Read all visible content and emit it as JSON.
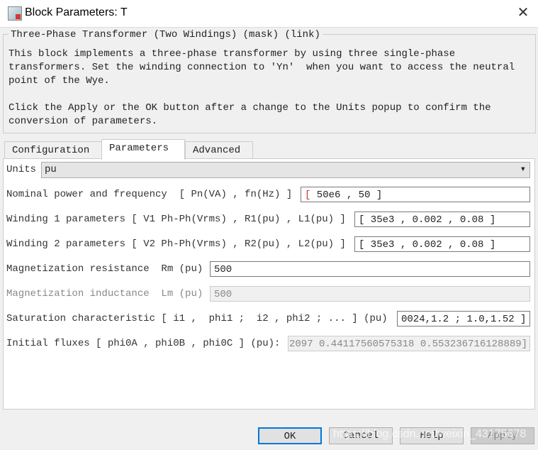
{
  "window": {
    "title": "Block Parameters: T",
    "close_icon": "close-icon"
  },
  "description": {
    "group_title": "Three-Phase Transformer (Two Windings) (mask) (link)",
    "lines": [
      "This block implements a three-phase transformer by using three single-phase",
      "transformers. Set the winding connection to 'Yn'  when you want to access the neutral",
      "point of the Wye.",
      "",
      "Click the Apply or the OK button after a change to the Units popup to confirm the",
      "conversion of parameters."
    ]
  },
  "tabs": [
    {
      "label": "Configuration"
    },
    {
      "label": "Parameters",
      "active": true
    },
    {
      "label": "Advanced"
    }
  ],
  "params": {
    "units": {
      "label": "Units",
      "value": "pu"
    },
    "nominal": {
      "label": "Nominal power and frequency  [ Pn(VA) , fn(Hz) ]",
      "value": " 50e6 , 50 ]"
    },
    "winding1": {
      "label": "Winding 1 parameters [ V1 Ph-Ph(Vrms) , R1(pu) , L1(pu) ]",
      "value": " 35e3 , 0.002 , 0.08 ]"
    },
    "winding2": {
      "label": "Winding 2 parameters [ V2 Ph-Ph(Vrms) , R2(pu) , L2(pu) ]",
      "value": " 35e3 , 0.002 , 0.08 ]"
    },
    "rm": {
      "label": "Magnetization resistance  Rm (pu)",
      "value": "500"
    },
    "lm": {
      "label": "Magnetization inductance  Lm (pu)",
      "value": "500"
    },
    "saturation": {
      "label": "Saturation characteristic [ i1 ,  phi1 ;  i2 , phi2 ; ... ] (pu)",
      "value": "0024,1.2 ; 1.0,1.52 ]"
    },
    "fluxes": {
      "label": "Initial fluxes [ phi0A , phi0B , phi0C ] (pu):",
      "value": "2097 0.44117560575318 0.553236716128889]"
    }
  },
  "buttons": {
    "ok": "OK",
    "cancel": "Cancel",
    "help": "Help",
    "apply": "Apply"
  },
  "watermark": "https://blog.csdn.net/weixin_43175678"
}
